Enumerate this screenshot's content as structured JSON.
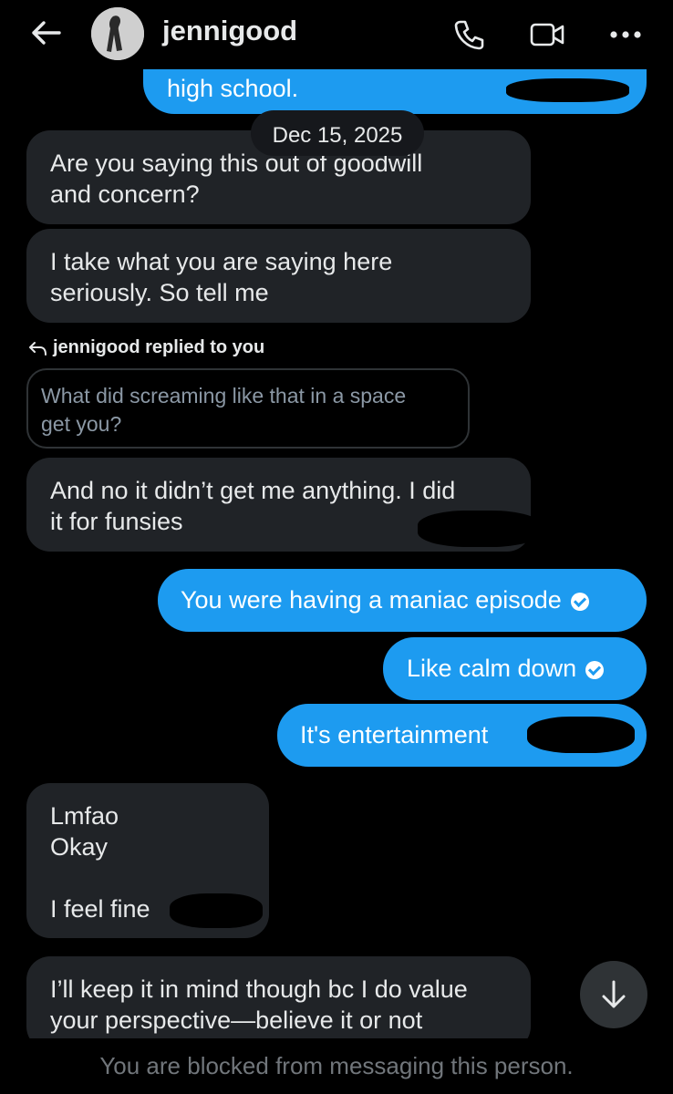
{
  "header": {
    "username": "jennigood"
  },
  "conversation": {
    "partial_out_message": "high school.",
    "date_divider": "Dec 15, 2025",
    "incoming_1": [
      "Are you saying this out of goodwill",
      "and concern?"
    ],
    "incoming_2": [
      "I take what you are saying here",
      "seriously. So tell me"
    ],
    "reply_label": "jennigood replied to you",
    "quoted_message": [
      "What did screaming like that in a space",
      "get you?"
    ],
    "incoming_3": [
      "And no it didn’t get me anything. I did",
      "it for funsies"
    ],
    "outgoing_1": "You were having a maniac episode",
    "outgoing_2": "Like calm down",
    "outgoing_3": "It's entertainment",
    "incoming_4": [
      "Lmfao",
      "Okay",
      "",
      "I feel fine"
    ],
    "incoming_5": [
      "I’ll keep it in mind though bc I do value",
      "your perspective—believe it or not"
    ]
  },
  "footer": {
    "blocked_text": "You are blocked from messaging this person."
  },
  "colors": {
    "background": "#000000",
    "incoming_bubble": "#202327",
    "outgoing_bubble": "#1d9bf0",
    "muted_text": "#71767b"
  },
  "icons": [
    "back-arrow-icon",
    "phone-icon",
    "video-camera-icon",
    "more-icon",
    "reply-arrow-icon",
    "sent-check-icon",
    "arrow-down-icon"
  ]
}
